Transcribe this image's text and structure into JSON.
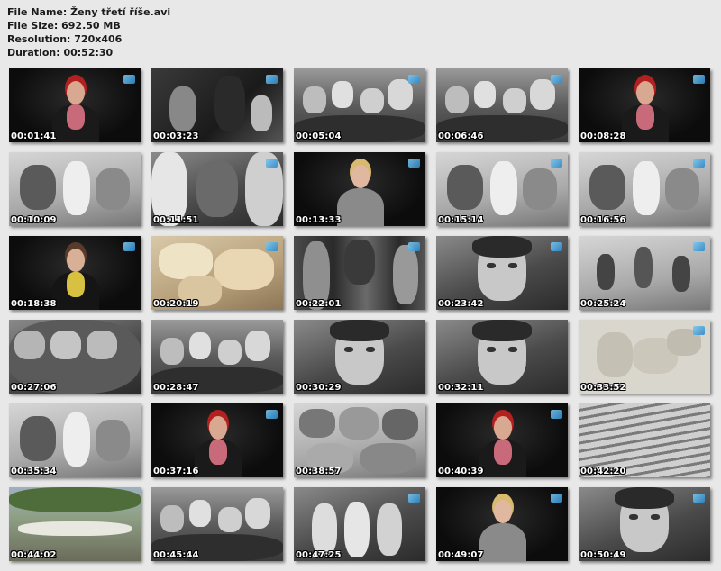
{
  "header": {
    "file_name": "File Name: Ženy třetí říše.avi",
    "file_size": "File Size: 692.50 MB",
    "resolution": "Resolution: 720x406",
    "duration": "Duration: 00:52:30"
  },
  "thumbnails": [
    {
      "time": "00:01:41",
      "scene": "studio-woman-red",
      "logo": true
    },
    {
      "time": "00:03:23",
      "scene": "archive-dark",
      "logo": true
    },
    {
      "time": "00:05:04",
      "scene": "archive-crowd",
      "logo": true
    },
    {
      "time": "00:06:46",
      "scene": "archive-crowd",
      "logo": true
    },
    {
      "time": "00:08:28",
      "scene": "studio-woman-red",
      "logo": true
    },
    {
      "time": "00:10:09",
      "scene": "archive-light",
      "logo": false
    },
    {
      "time": "00:11:51",
      "scene": "archive-corridor",
      "logo": true
    },
    {
      "time": "00:13:33",
      "scene": "studio-woman-blonde",
      "logo": true
    },
    {
      "time": "00:15:14",
      "scene": "archive-light",
      "logo": true
    },
    {
      "time": "00:16:56",
      "scene": "archive-light",
      "logo": true
    },
    {
      "time": "00:18:38",
      "scene": "studio-woman-dark",
      "logo": true
    },
    {
      "time": "00:20:19",
      "scene": "sepia-documents",
      "logo": true
    },
    {
      "time": "00:22:01",
      "scene": "archive-flags",
      "logo": true
    },
    {
      "time": "00:23:42",
      "scene": "archive-portrait",
      "logo": true
    },
    {
      "time": "00:25:24",
      "scene": "archive-gymnastics",
      "logo": true
    },
    {
      "time": "00:27:06",
      "scene": "archive-train",
      "logo": false
    },
    {
      "time": "00:28:47",
      "scene": "archive-crowd",
      "logo": false
    },
    {
      "time": "00:30:29",
      "scene": "archive-portrait",
      "logo": false
    },
    {
      "time": "00:32:11",
      "scene": "archive-portrait",
      "logo": false
    },
    {
      "time": "00:33:52",
      "scene": "map",
      "logo": true
    },
    {
      "time": "00:35:34",
      "scene": "archive-light",
      "logo": false
    },
    {
      "time": "00:37:16",
      "scene": "studio-woman-red",
      "logo": true
    },
    {
      "time": "00:38:57",
      "scene": "archive-collage",
      "logo": false
    },
    {
      "time": "00:40:39",
      "scene": "studio-woman-red",
      "logo": true
    },
    {
      "time": "00:42:20",
      "scene": "archive-rows",
      "logo": false
    },
    {
      "time": "00:44:02",
      "scene": "color-landscape",
      "logo": false
    },
    {
      "time": "00:45:44",
      "scene": "archive-crowd",
      "logo": false
    },
    {
      "time": "00:47:25",
      "scene": "archive-women",
      "logo": true
    },
    {
      "time": "00:49:07",
      "scene": "studio-woman-blonde",
      "logo": true
    },
    {
      "time": "00:50:49",
      "scene": "archive-portrait",
      "logo": true
    }
  ]
}
